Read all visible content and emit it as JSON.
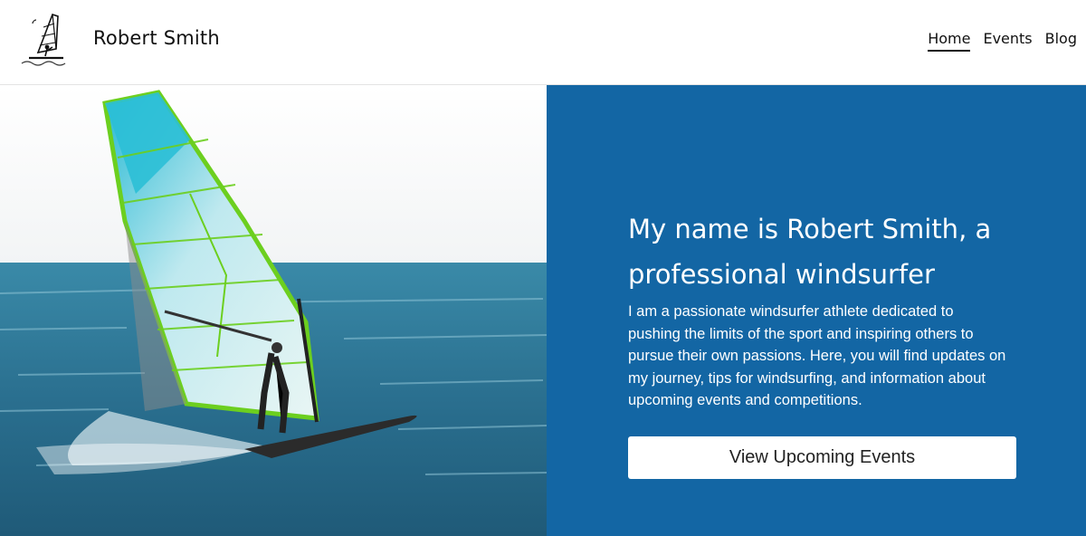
{
  "header": {
    "site_name": "Robert Smith",
    "logo_icon": "windsurfer-logo-icon",
    "nav": [
      {
        "label": "Home",
        "active": true
      },
      {
        "label": "Events",
        "active": false
      },
      {
        "label": "Blog",
        "active": false
      }
    ]
  },
  "hero": {
    "image": "windsurfer-photo",
    "title": "My name is Robert Smith, a professional windsurfer",
    "description": "I am a passionate windsurfer athlete dedicated to pushing the limits of the sport and inspiring others to pursue their own passions. Here, you will find updates on my journey, tips for windsurfing, and information about upcoming events and competitions.",
    "button_label": "View Upcoming Events"
  },
  "colors": {
    "panel_background": "#1366a4",
    "sail_cyan": "#2bbfd6",
    "sail_green": "#7ed321",
    "sea": "#2a6f8f"
  }
}
